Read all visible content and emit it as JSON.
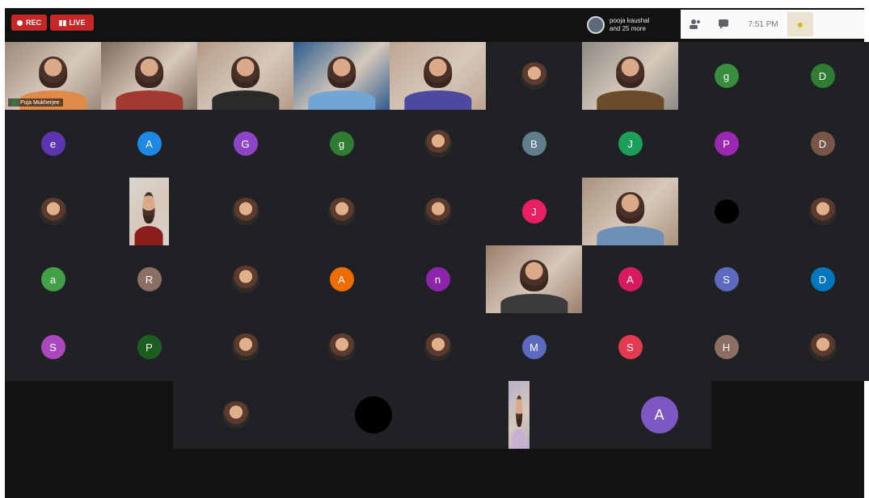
{
  "topbar": {
    "rec_label": "REC",
    "live_label": "LIVE",
    "presenter_line1": "pooja kaushal",
    "presenter_line2": "and 25 more",
    "clock": "7:51 PM"
  },
  "icons": {
    "people": "people-icon",
    "chat": "chat-icon",
    "self": "self-view-icon"
  },
  "rows": [
    [
      {
        "kind": "video",
        "name": "Puja Mukherjee",
        "bg": "#9a8a7c",
        "shirt": "#e08a4a"
      },
      {
        "kind": "video",
        "bg": "#7d6a5e",
        "shirt": "#a33a2f"
      },
      {
        "kind": "video",
        "bg": "#b49a86",
        "shirt": "#2a2a2a"
      },
      {
        "kind": "video",
        "bg": "#2e5b8f",
        "shirt": "#6fa6d6"
      },
      {
        "kind": "video",
        "bg": "#bfa592",
        "shirt": "#4c4a9e"
      },
      {
        "kind": "photo"
      },
      {
        "kind": "video",
        "bg": "#8c8a84",
        "shirt": "#6b4c2a"
      },
      {
        "kind": "initial",
        "letter": "g",
        "color": "#388e3c"
      },
      {
        "kind": "initial",
        "letter": "D",
        "color": "#2e7d32"
      }
    ],
    [
      {
        "kind": "initial",
        "letter": "e",
        "color": "#5e35b1"
      },
      {
        "kind": "initial",
        "letter": "A",
        "color": "#1e88e5"
      },
      {
        "kind": "initial",
        "letter": "G",
        "color": "#8e44c8"
      },
      {
        "kind": "initial",
        "letter": "g",
        "color": "#2e7d32"
      },
      {
        "kind": "photo"
      },
      {
        "kind": "initial",
        "letter": "B",
        "color": "#607d8b"
      },
      {
        "kind": "initial",
        "letter": "J",
        "color": "#1b9e5a"
      },
      {
        "kind": "initial",
        "letter": "P",
        "color": "#9c27b0"
      },
      {
        "kind": "initial",
        "letter": "D",
        "color": "#795548"
      }
    ],
    [
      {
        "kind": "photo"
      },
      {
        "kind": "portrait",
        "bg": "#d9d4cf",
        "shirt": "#8b1d1d"
      },
      {
        "kind": "photo"
      },
      {
        "kind": "photo"
      },
      {
        "kind": "photo"
      },
      {
        "kind": "initial",
        "letter": "J",
        "color": "#e91e63"
      },
      {
        "kind": "video",
        "bg": "#a8927c",
        "shirt": "#6e8fb8"
      },
      {
        "kind": "initial",
        "letter": "",
        "color": "#000000"
      },
      {
        "kind": "photo"
      }
    ],
    [
      {
        "kind": "initial",
        "letter": "a",
        "color": "#43a047"
      },
      {
        "kind": "initial",
        "letter": "R",
        "color": "#8d6e63"
      },
      {
        "kind": "photo"
      },
      {
        "kind": "initial",
        "letter": "A",
        "color": "#ef6c00"
      },
      {
        "kind": "initial",
        "letter": "n",
        "color": "#8e24aa"
      },
      {
        "kind": "video",
        "bg": "#9b7e6a",
        "shirt": "#3b3b3b"
      },
      {
        "kind": "initial",
        "letter": "A",
        "color": "#d81b60"
      },
      {
        "kind": "initial",
        "letter": "S",
        "color": "#5c6bc0"
      },
      {
        "kind": "initial",
        "letter": "D",
        "color": "#0277bd"
      }
    ],
    [
      {
        "kind": "initial",
        "letter": "S",
        "color": "#ab47bc"
      },
      {
        "kind": "initial",
        "letter": "P",
        "color": "#1b5e20"
      },
      {
        "kind": "photo"
      },
      {
        "kind": "photo"
      },
      {
        "kind": "photo"
      },
      {
        "kind": "initial",
        "letter": "M",
        "color": "#5c6bc0"
      },
      {
        "kind": "initial",
        "letter": "S",
        "color": "#e53950"
      },
      {
        "kind": "initial",
        "letter": "H",
        "color": "#8d6e63"
      },
      {
        "kind": "photo"
      }
    ]
  ],
  "bottom_row": [
    {
      "kind": "photo"
    },
    {
      "kind": "initial",
      "letter": "",
      "color": "#000000",
      "big": true
    },
    {
      "kind": "portrait",
      "bg": "#b7b0c8",
      "shirt": "#c7b2d4"
    },
    {
      "kind": "initial",
      "letter": "A",
      "color": "#7e57c2",
      "big": true
    }
  ]
}
